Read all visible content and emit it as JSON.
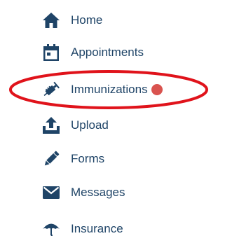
{
  "nav": {
    "items": [
      {
        "label": "Home",
        "icon": "home-icon"
      },
      {
        "label": "Appointments",
        "icon": "calendar-icon"
      },
      {
        "label": "Immunizations",
        "icon": "syringe-icon",
        "badge": "notification-dot"
      },
      {
        "label": "Upload",
        "icon": "upload-icon"
      },
      {
        "label": "Forms",
        "icon": "pencil-icon"
      },
      {
        "label": "Messages",
        "icon": "envelope-icon"
      },
      {
        "label": "Insurance",
        "icon": "umbrella-icon"
      }
    ]
  },
  "colors": {
    "icon": "#1f4467",
    "text": "#1f4467",
    "badge": "#d9534f",
    "highlight_ring": "#e0131b"
  }
}
